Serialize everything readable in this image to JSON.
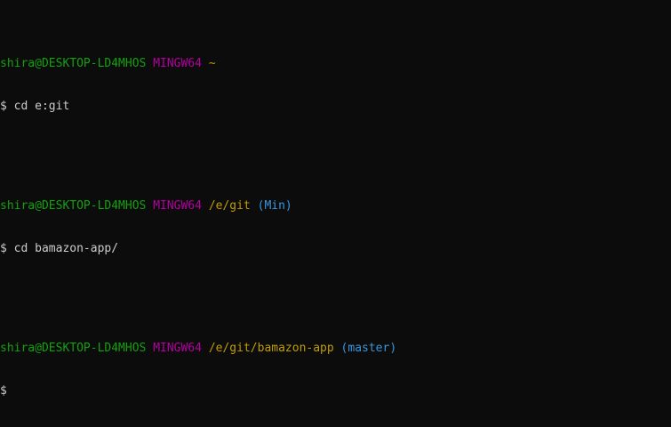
{
  "blocks": [
    {
      "user_host": "shira@DESKTOP-LD4MHOS",
      "system": "MINGW64",
      "path": "~",
      "branch": "",
      "prompt": "$",
      "command": "cd e:git"
    },
    {
      "user_host": "shira@DESKTOP-LD4MHOS",
      "system": "MINGW64",
      "path": "/e/git",
      "branch": "(Min)",
      "prompt": "$",
      "command": "cd bamazon-app/"
    },
    {
      "user_host": "shira@DESKTOP-LD4MHOS",
      "system": "MINGW64",
      "path": "/e/git/bamazon-app",
      "branch": "(master)",
      "prompt": "$",
      "command": ""
    }
  ],
  "colors": {
    "background": "#0c0c0c",
    "user_host": "#13a10e",
    "system": "#b4009e",
    "path": "#c19c00",
    "branch": "#3a96dd",
    "text": "#cccccc"
  }
}
